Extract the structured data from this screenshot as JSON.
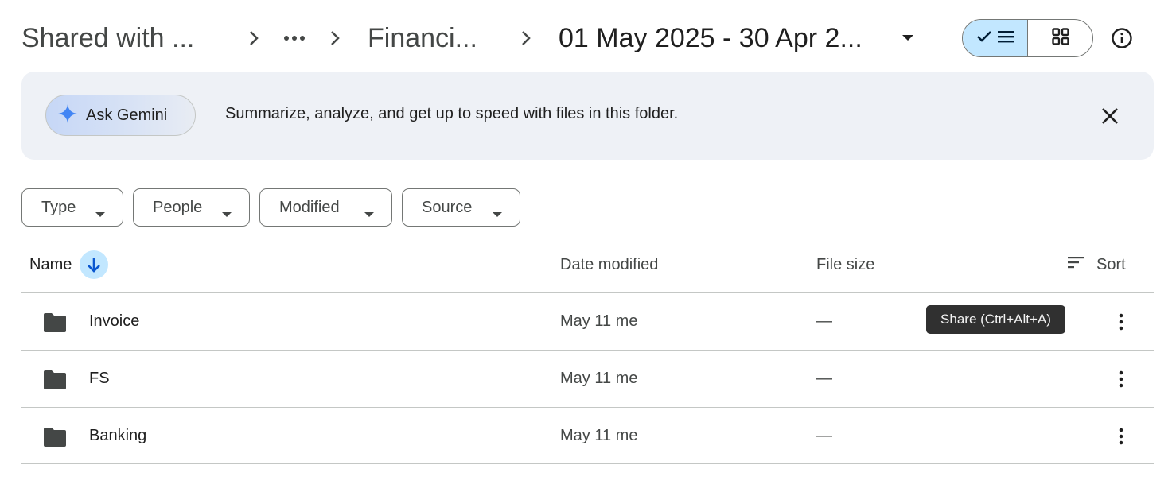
{
  "breadcrumb": {
    "items": [
      "Shared with ...",
      "Financi...",
      "01 May 2025 - 30 Apr 2..."
    ],
    "more_label": "more-horizontal-icon"
  },
  "view_toggle": {
    "list_icon": "check-list-icon",
    "grid_icon": "grid-icon",
    "active": "list"
  },
  "banner": {
    "button_label": "Ask Gemini",
    "text": "Summarize, analyze, and get up to speed with files in this folder."
  },
  "filters": [
    "Type",
    "People",
    "Modified",
    "Source"
  ],
  "table": {
    "headers": {
      "name": "Name",
      "date": "Date modified",
      "size": "File size",
      "sort": "Sort"
    },
    "rows": [
      {
        "name": "Invoice",
        "date": "May 11 me",
        "size": "—"
      },
      {
        "name": "FS",
        "date": "May 11 me",
        "size": "—"
      },
      {
        "name": "Banking",
        "date": "May 11 me",
        "size": "—"
      }
    ]
  },
  "tooltip": "Share (Ctrl+Alt+A)",
  "colors": {
    "accent": "#c2e7ff",
    "banner_bg": "#eef1f6",
    "gemini_star": "#4285f4"
  }
}
